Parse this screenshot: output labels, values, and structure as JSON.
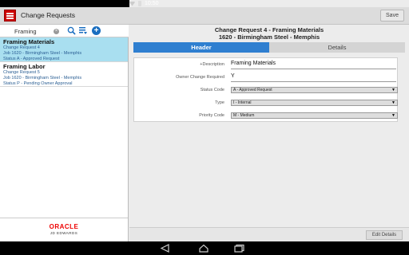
{
  "status_bar": {
    "time": "10:50"
  },
  "app": {
    "title": "Change Requests",
    "save_label": "Save"
  },
  "search": {
    "value": "Framing"
  },
  "list_items": [
    {
      "title": "Framing Materials",
      "line1": "Change Request 4",
      "line2": "Job 1620 - Birmingham Steel - Memphis",
      "line3": "Status A - Approved Request"
    },
    {
      "title": "Framing Labor",
      "line1": "Change Request 5",
      "line2": "Job 1620 - Birmingham Steel - Memphis",
      "line3": "Status P - Pending Owner Approval"
    }
  ],
  "branding": {
    "oracle": "ORACLE",
    "jde": "JD EDWARDS"
  },
  "detail": {
    "title_line1": "Change Request 4 - Framing Materials",
    "title_line2": "1620 - Birmingham Steel - Memphis",
    "tabs": {
      "header": "Header",
      "details": "Details"
    },
    "fields": {
      "description_label": "+Description",
      "description_value": "Framing Materials",
      "owner_label": "Owner Change Required",
      "owner_value": "Y",
      "status_label": "Status Code",
      "status_value": "A - Approved Request",
      "type_label": "Type",
      "type_value": "I - Internal",
      "priority_label": "Priority Code",
      "priority_value": "M - Medium"
    },
    "edit_label": "Edit Details"
  },
  "colors": {
    "accent": "#2f7fd0",
    "selected": "#a9dff0",
    "brand": "#cc0000"
  }
}
